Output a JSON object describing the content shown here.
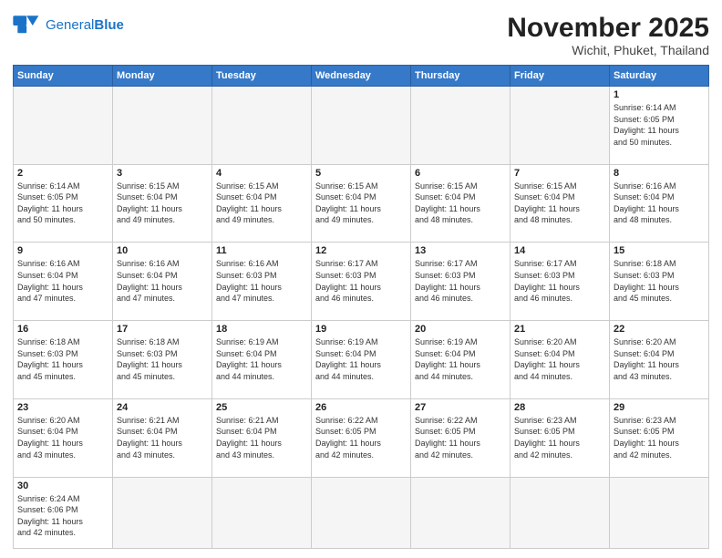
{
  "header": {
    "logo_general": "General",
    "logo_blue": "Blue",
    "month_title": "November 2025",
    "subtitle": "Wichit, Phuket, Thailand"
  },
  "weekdays": [
    "Sunday",
    "Monday",
    "Tuesday",
    "Wednesday",
    "Thursday",
    "Friday",
    "Saturday"
  ],
  "weeks": [
    [
      {
        "day": "",
        "info": ""
      },
      {
        "day": "",
        "info": ""
      },
      {
        "day": "",
        "info": ""
      },
      {
        "day": "",
        "info": ""
      },
      {
        "day": "",
        "info": ""
      },
      {
        "day": "",
        "info": ""
      },
      {
        "day": "1",
        "info": "Sunrise: 6:14 AM\nSunset: 6:05 PM\nDaylight: 11 hours\nand 50 minutes."
      }
    ],
    [
      {
        "day": "2",
        "info": "Sunrise: 6:14 AM\nSunset: 6:05 PM\nDaylight: 11 hours\nand 50 minutes."
      },
      {
        "day": "3",
        "info": "Sunrise: 6:15 AM\nSunset: 6:04 PM\nDaylight: 11 hours\nand 49 minutes."
      },
      {
        "day": "4",
        "info": "Sunrise: 6:15 AM\nSunset: 6:04 PM\nDaylight: 11 hours\nand 49 minutes."
      },
      {
        "day": "5",
        "info": "Sunrise: 6:15 AM\nSunset: 6:04 PM\nDaylight: 11 hours\nand 49 minutes."
      },
      {
        "day": "6",
        "info": "Sunrise: 6:15 AM\nSunset: 6:04 PM\nDaylight: 11 hours\nand 48 minutes."
      },
      {
        "day": "7",
        "info": "Sunrise: 6:15 AM\nSunset: 6:04 PM\nDaylight: 11 hours\nand 48 minutes."
      },
      {
        "day": "8",
        "info": "Sunrise: 6:16 AM\nSunset: 6:04 PM\nDaylight: 11 hours\nand 48 minutes."
      }
    ],
    [
      {
        "day": "9",
        "info": "Sunrise: 6:16 AM\nSunset: 6:04 PM\nDaylight: 11 hours\nand 47 minutes."
      },
      {
        "day": "10",
        "info": "Sunrise: 6:16 AM\nSunset: 6:04 PM\nDaylight: 11 hours\nand 47 minutes."
      },
      {
        "day": "11",
        "info": "Sunrise: 6:16 AM\nSunset: 6:03 PM\nDaylight: 11 hours\nand 47 minutes."
      },
      {
        "day": "12",
        "info": "Sunrise: 6:17 AM\nSunset: 6:03 PM\nDaylight: 11 hours\nand 46 minutes."
      },
      {
        "day": "13",
        "info": "Sunrise: 6:17 AM\nSunset: 6:03 PM\nDaylight: 11 hours\nand 46 minutes."
      },
      {
        "day": "14",
        "info": "Sunrise: 6:17 AM\nSunset: 6:03 PM\nDaylight: 11 hours\nand 46 minutes."
      },
      {
        "day": "15",
        "info": "Sunrise: 6:18 AM\nSunset: 6:03 PM\nDaylight: 11 hours\nand 45 minutes."
      }
    ],
    [
      {
        "day": "16",
        "info": "Sunrise: 6:18 AM\nSunset: 6:03 PM\nDaylight: 11 hours\nand 45 minutes."
      },
      {
        "day": "17",
        "info": "Sunrise: 6:18 AM\nSunset: 6:03 PM\nDaylight: 11 hours\nand 45 minutes."
      },
      {
        "day": "18",
        "info": "Sunrise: 6:19 AM\nSunset: 6:04 PM\nDaylight: 11 hours\nand 44 minutes."
      },
      {
        "day": "19",
        "info": "Sunrise: 6:19 AM\nSunset: 6:04 PM\nDaylight: 11 hours\nand 44 minutes."
      },
      {
        "day": "20",
        "info": "Sunrise: 6:19 AM\nSunset: 6:04 PM\nDaylight: 11 hours\nand 44 minutes."
      },
      {
        "day": "21",
        "info": "Sunrise: 6:20 AM\nSunset: 6:04 PM\nDaylight: 11 hours\nand 44 minutes."
      },
      {
        "day": "22",
        "info": "Sunrise: 6:20 AM\nSunset: 6:04 PM\nDaylight: 11 hours\nand 43 minutes."
      }
    ],
    [
      {
        "day": "23",
        "info": "Sunrise: 6:20 AM\nSunset: 6:04 PM\nDaylight: 11 hours\nand 43 minutes."
      },
      {
        "day": "24",
        "info": "Sunrise: 6:21 AM\nSunset: 6:04 PM\nDaylight: 11 hours\nand 43 minutes."
      },
      {
        "day": "25",
        "info": "Sunrise: 6:21 AM\nSunset: 6:04 PM\nDaylight: 11 hours\nand 43 minutes."
      },
      {
        "day": "26",
        "info": "Sunrise: 6:22 AM\nSunset: 6:05 PM\nDaylight: 11 hours\nand 42 minutes."
      },
      {
        "day": "27",
        "info": "Sunrise: 6:22 AM\nSunset: 6:05 PM\nDaylight: 11 hours\nand 42 minutes."
      },
      {
        "day": "28",
        "info": "Sunrise: 6:23 AM\nSunset: 6:05 PM\nDaylight: 11 hours\nand 42 minutes."
      },
      {
        "day": "29",
        "info": "Sunrise: 6:23 AM\nSunset: 6:05 PM\nDaylight: 11 hours\nand 42 minutes."
      }
    ],
    [
      {
        "day": "30",
        "info": "Sunrise: 6:24 AM\nSunset: 6:06 PM\nDaylight: 11 hours\nand 42 minutes."
      },
      {
        "day": "",
        "info": ""
      },
      {
        "day": "",
        "info": ""
      },
      {
        "day": "",
        "info": ""
      },
      {
        "day": "",
        "info": ""
      },
      {
        "day": "",
        "info": ""
      },
      {
        "day": "",
        "info": ""
      }
    ]
  ]
}
